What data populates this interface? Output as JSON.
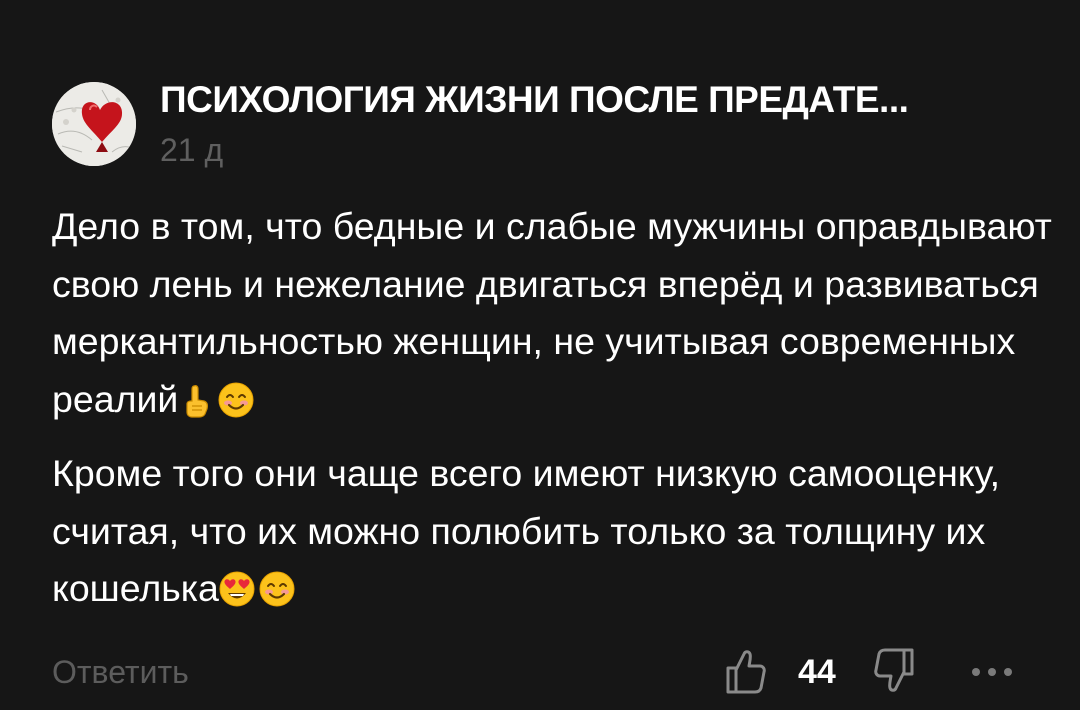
{
  "comment": {
    "author": "ПСИХОЛОГИЯ ЖИЗНИ ПОСЛЕ ПРЕДАТЕ...",
    "timestamp": "21 д",
    "paragraph1": "Дело в том, что бедные и слабые мужчины оправдывают свою лень и нежелание двигаться вперёд и развиваться меркантильностью женщин, не учитывая современных реалий",
    "paragraph2": "Кроме того они чаще всего имеют низкую самооценку, считая, что их можно полюбить только за толщину их кошелька",
    "reply_label": "Ответить",
    "like_count": "44"
  },
  "icons": {
    "avatar": "heart-logo",
    "like": "thumbs-up-icon",
    "dislike": "thumbs-down-icon",
    "more": "more-dots-icon",
    "emoji_point": "pointing-up-emoji",
    "emoji_smile": "smiling-face-emoji",
    "emoji_heart_eyes": "heart-eyes-emoji"
  },
  "colors": {
    "background": "#161616",
    "text": "#ffffff",
    "muted": "#5f5f5f"
  }
}
